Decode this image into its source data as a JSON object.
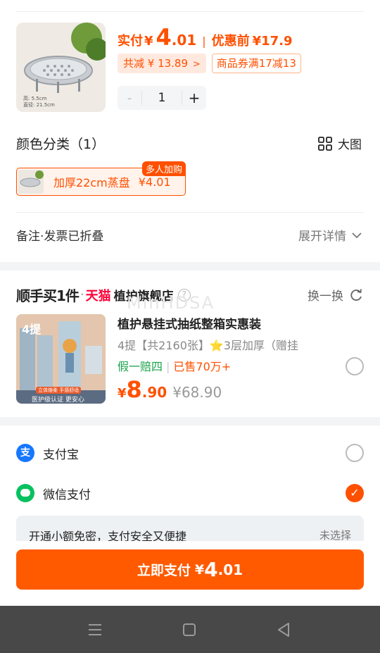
{
  "order": {
    "paid_label": "实付",
    "currency": "¥",
    "paid_int": "4",
    "paid_dec": ".01",
    "separator": "|",
    "before_label": "优惠前",
    "before_price": "¥17.9",
    "discount_tag": "共减 ¥ 13.89",
    "coupon_tag": "商品券满17减13",
    "qty_minus": "-",
    "qty": "1",
    "qty_plus": "+",
    "thumb_caption_line1": "高: 5.5cm",
    "thumb_caption_line2": "直径: 21.5cm"
  },
  "variants": {
    "title": "颜色分类（1）",
    "big_image_label": "大图",
    "item_label": "加厚22cm蒸盘",
    "item_price": "¥4.01",
    "badge": "多人加购"
  },
  "notes": {
    "label": "备注·发票已折叠",
    "expand_label": "展开详情"
  },
  "recommend": {
    "brand_label": "顺手买1件",
    "dot": "·",
    "tmall": "天猫",
    "store": "植护旗舰店",
    "help": "?",
    "swap_label": "换一换",
    "watermark": "MinHDSA",
    "title": "植护悬挂式抽纸整箱实惠装",
    "subtitle": "4提【共2160张】⭐3层加厚（赠挂",
    "guarantee": "假一赔四",
    "sep": "|",
    "sold": "已售70万+",
    "currency": "¥",
    "price_int": "8",
    "price_dec": ".90",
    "orig_price": "¥68.90",
    "thumb_badge": "4提",
    "thumb_banner": "立体熔柔 手感舒适",
    "thumb_footer": "医护级认证 更安心"
  },
  "payment": {
    "alipay_label": "支付宝",
    "alipay_icon": "支",
    "wechat_label": "微信支付",
    "tip_text": "开通小额免密，支付安全又便捷",
    "tip_status": "未选择",
    "pay_button_label": "立即支付",
    "pay_currency": "¥",
    "pay_int": "4",
    "pay_dec": ".01"
  },
  "colors": {
    "accent": "#ff5000",
    "tmall_red": "#ff0036",
    "green": "#17a34a",
    "navbar": "#484848"
  }
}
